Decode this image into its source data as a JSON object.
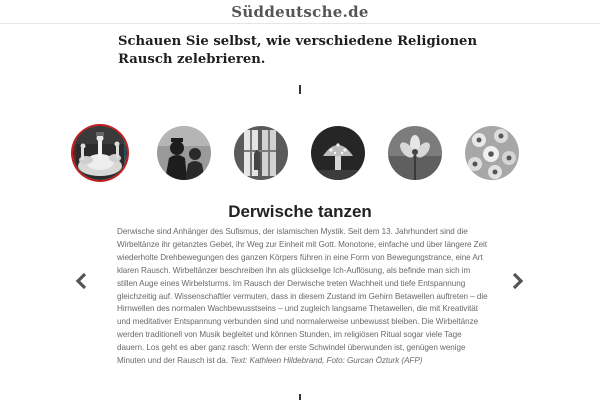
{
  "masthead": {
    "logo_text": "Süddeutsche.de"
  },
  "intro": {
    "text": "Schauen Sie selbst, wie verschiedene Religionen Rausch zelebrieren."
  },
  "gallery": {
    "thumbnails": [
      {
        "subject": "whirling dervishes",
        "selected": true
      },
      {
        "subject": "silhouettes",
        "selected": false
      },
      {
        "subject": "window light",
        "selected": false
      },
      {
        "subject": "mushroom",
        "selected": false
      },
      {
        "subject": "flower",
        "selected": false
      },
      {
        "subject": "flower pattern",
        "selected": false
      }
    ],
    "active": {
      "title": "Derwische tanzen",
      "body": "Derwische sind Anhänger des Sufismus, der islamischen Mystik. Seit dem 13. Jahrhundert sind die Wirbeltänze ihr getanztes Gebet, ihr Weg zur Einheit mit Gott. Monotone, einfache und über längere Zeit wiederholte Drehbewegungen des ganzen Körpers führen in eine Form von Bewegungstrance, eine Art klaren Rausch. Wirbeltänzer beschreiben ihn als glückselige Ich-Auflösung, als befinde man sich im stillen Auge eines Wirbelsturms. Im Rausch der Derwische treten Wachheit und tiefe Entspannung gleichzeitig auf. Wissenschaftler vermuten, dass in diesem Zustand im Gehirn Betawellen auftreten – die Hirnwellen des normalen Wachbewusstseins – und zugleich langsame Thetawellen, die mit Kreativität und meditativer Entspannung verbunden sind und normalerweise unbewusst bleiben. Die Wirbeltänze werden traditionell von Musik begleitet und können Stunden, im religiösen Ritual sogar viele Tage dauern. Los geht es aber ganz rasch: Wenn der erste Schwindel überwunden ist, genügen wenige Minuten und der Rausch ist da.",
      "credit": "Text: Kathleen Hildebrand, Foto: Gurcan Özturk (AFP)"
    }
  },
  "icons": {
    "prev": "chevron-left-icon",
    "next": "chevron-right-icon"
  },
  "colors": {
    "active_ring": "#c21e1e",
    "body_text": "#6a6a6a",
    "title_text": "#222222"
  }
}
